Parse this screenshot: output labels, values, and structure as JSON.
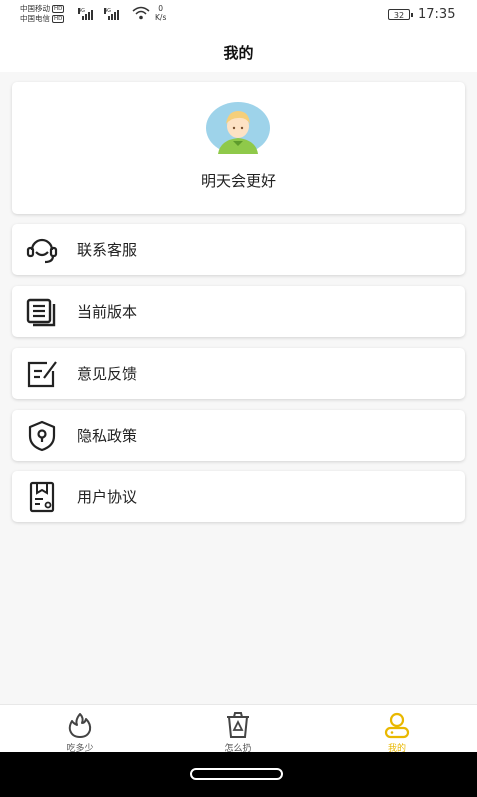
{
  "status_bar": {
    "carrier1": "中国移动",
    "carrier2": "中国电信",
    "hd_badge": "HD",
    "net_type": "4G",
    "net_speed_value": "0",
    "net_speed_unit": "K/s",
    "battery": "32",
    "time": "17:35"
  },
  "header": {
    "title": "我的"
  },
  "profile": {
    "username": "明天会更好",
    "avatar_icon": "user-avatar-icon"
  },
  "menu": [
    {
      "label": "联系客服",
      "icon": "headset-icon"
    },
    {
      "label": "当前版本",
      "icon": "version-list-icon"
    },
    {
      "label": "意见反馈",
      "icon": "feedback-edit-icon"
    },
    {
      "label": "隐私政策",
      "icon": "privacy-shield-icon"
    },
    {
      "label": "用户协议",
      "icon": "agreement-doc-icon"
    }
  ],
  "tabs": [
    {
      "label": "吃多少",
      "icon": "flame-icon",
      "active": false
    },
    {
      "label": "怎么扔",
      "icon": "trash-bin-icon",
      "active": false
    },
    {
      "label": "我的",
      "icon": "person-icon",
      "active": true
    }
  ],
  "colors": {
    "accent": "#e9b800",
    "background": "#f7f7f7",
    "card": "#ffffff"
  }
}
